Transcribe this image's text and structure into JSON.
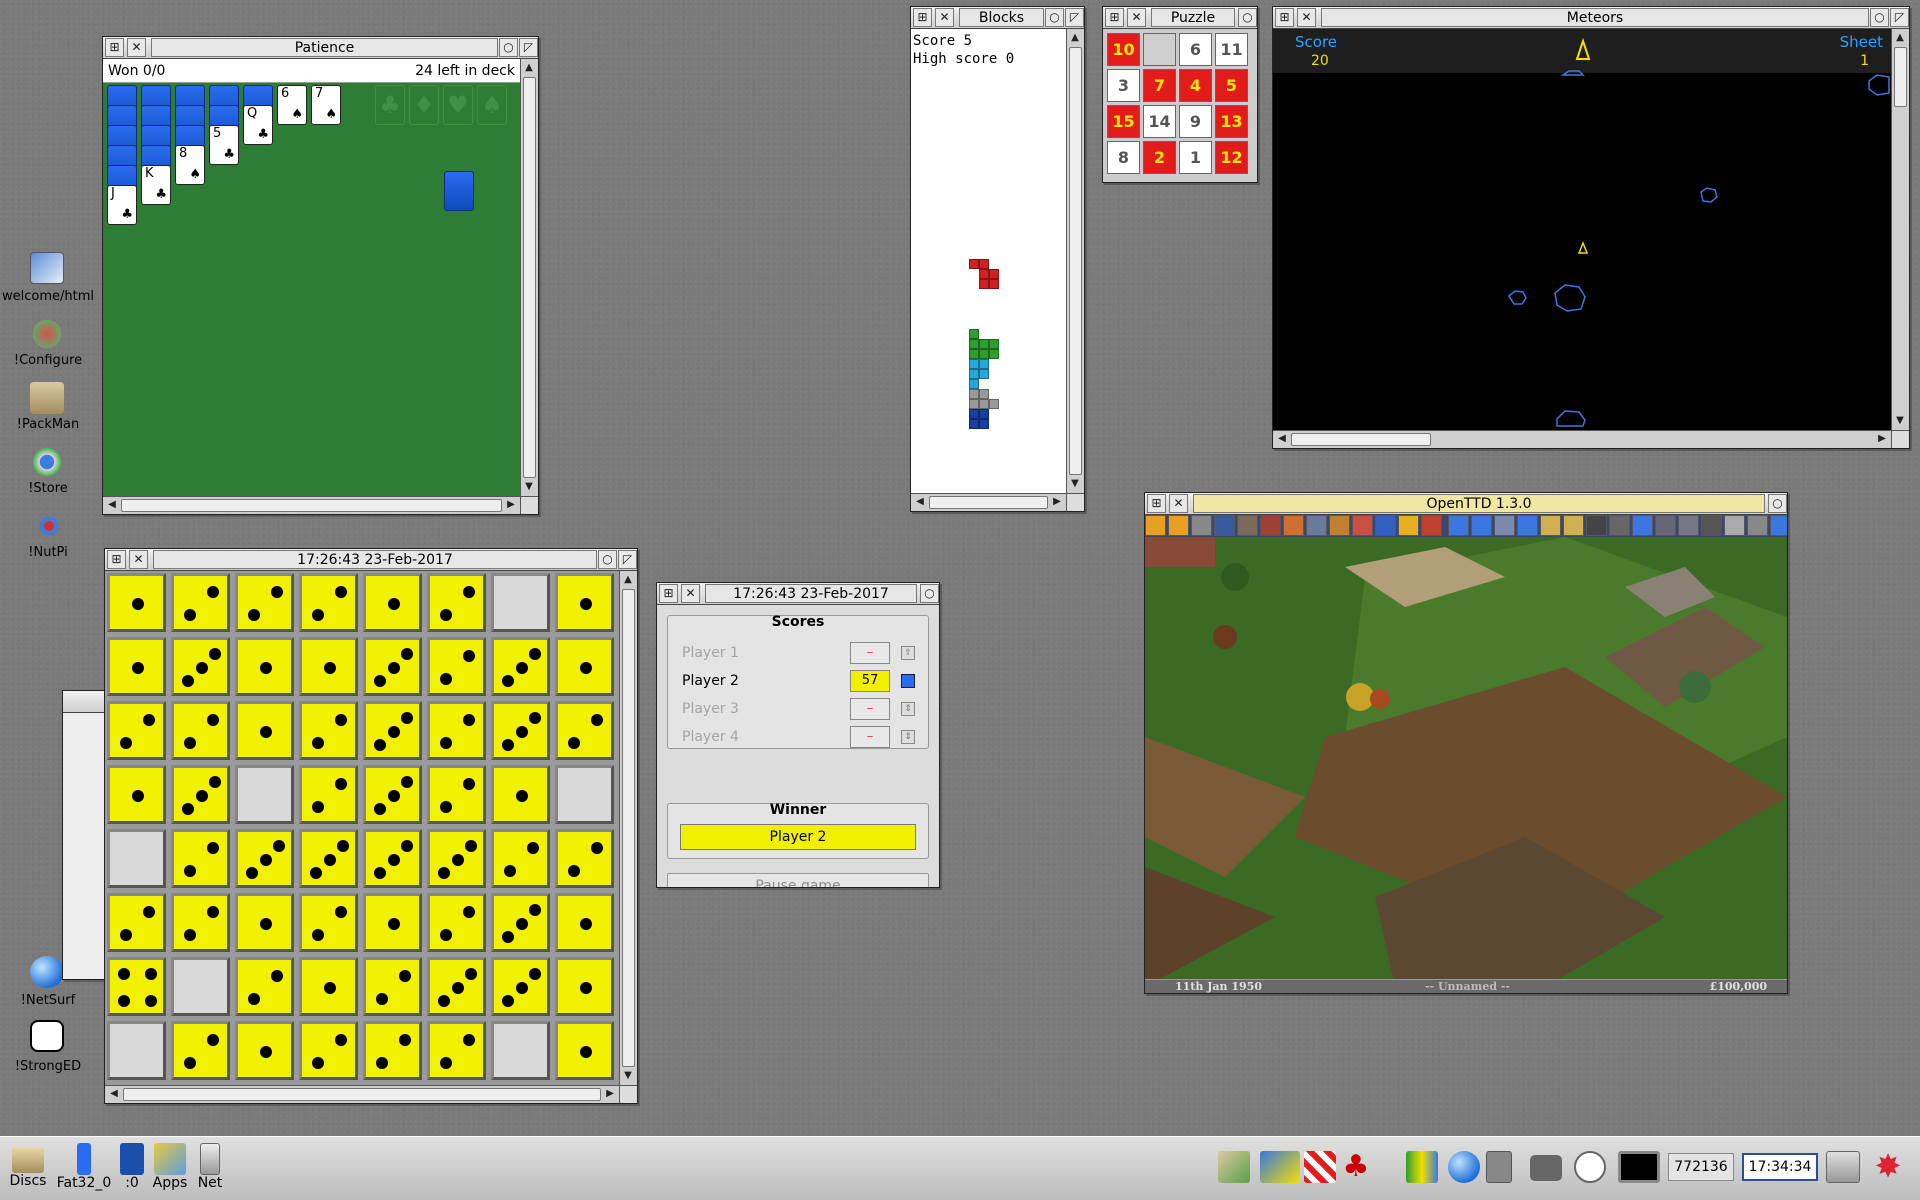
{
  "desktop_icons": [
    {
      "label": "welcome/html"
    },
    {
      "label": "!Configure"
    },
    {
      "label": "!PackMan"
    },
    {
      "label": "!Store"
    },
    {
      "label": "!NutPi"
    },
    {
      "label": "!NetSurf"
    },
    {
      "label": "!StrongED"
    }
  ],
  "patience": {
    "title": "Patience",
    "won": "Won 0/0",
    "left": "24 left in deck",
    "columns": [
      {
        "face": "J",
        "suit": "♣",
        "backs": 5
      },
      {
        "face": "K",
        "suit": "♣",
        "backs": 4
      },
      {
        "face": "8",
        "suit": "♠",
        "backs": 3
      },
      {
        "face": "5",
        "suit": "♣",
        "backs": 2
      },
      {
        "face": "Q",
        "suit": "♣",
        "backs": 1
      },
      {
        "face": "6",
        "suit": "♠",
        "backs": 0
      },
      {
        "face": "7",
        "suit": "♠",
        "backs": 0
      }
    ],
    "foundations": [
      "♣",
      "♦",
      "♥",
      "♠"
    ]
  },
  "blocks": {
    "title": "Blocks",
    "score": "Score 5",
    "high_score": "High score 0"
  },
  "puzzle": {
    "title": "Puzzle",
    "tiles": [
      "10",
      "",
      "6",
      "11",
      "3",
      "7",
      "4",
      "5",
      "15",
      "14",
      "9",
      "13",
      "8",
      "2",
      "1",
      "12"
    ],
    "tile_colors": [
      "r",
      "e",
      "w",
      "w",
      "w",
      "r",
      "r",
      "r",
      "r",
      "w",
      "w",
      "r",
      "w",
      "r",
      "w",
      "r"
    ]
  },
  "meteors": {
    "title": "Meteors",
    "score_label": "Score",
    "score": "20",
    "sheet_label": "Sheet",
    "sheet": "1"
  },
  "dice": {
    "title": "17:26:43 23-Feb-2017",
    "grid": [
      [
        1,
        2,
        2,
        2,
        1,
        2,
        0,
        1
      ],
      [
        1,
        3,
        1,
        1,
        3,
        2,
        3,
        1
      ],
      [
        2,
        2,
        1,
        2,
        3,
        2,
        3,
        2
      ],
      [
        1,
        3,
        0,
        2,
        3,
        2,
        1,
        0
      ],
      [
        0,
        2,
        3,
        3,
        3,
        3,
        2,
        2
      ],
      [
        2,
        2,
        1,
        2,
        1,
        2,
        3,
        1
      ],
      [
        4,
        0,
        2,
        1,
        2,
        3,
        3,
        1
      ],
      [
        0,
        2,
        1,
        2,
        2,
        2,
        0,
        1
      ]
    ],
    "colors": {
      "die": "#f0f000",
      "blank": "#d8d8d8"
    }
  },
  "scores": {
    "title": "17:26:43 23-Feb-2017",
    "heading": "Scores",
    "players": [
      {
        "name": "Player 1",
        "score": "–",
        "active": false
      },
      {
        "name": "Player 2",
        "score": "57",
        "active": true
      },
      {
        "name": "Player 3",
        "score": "–",
        "active": false
      },
      {
        "name": "Player 4",
        "score": "–",
        "active": false
      }
    ],
    "winner_heading": "Winner",
    "winner": "Player 2",
    "pause": "Pause game"
  },
  "openttd": {
    "title": "OpenTTD 1.3.0",
    "date": "11th Jan 1950",
    "company": "-- Unnamed --",
    "money": "£100,000"
  },
  "iconbar": {
    "left": [
      {
        "label": "Discs"
      },
      {
        "label": "Fat32_0"
      },
      {
        "label": ":0"
      },
      {
        "label": "Apps"
      },
      {
        "label": "Net"
      }
    ],
    "memory": "772136",
    "clock": "17:34:34"
  }
}
